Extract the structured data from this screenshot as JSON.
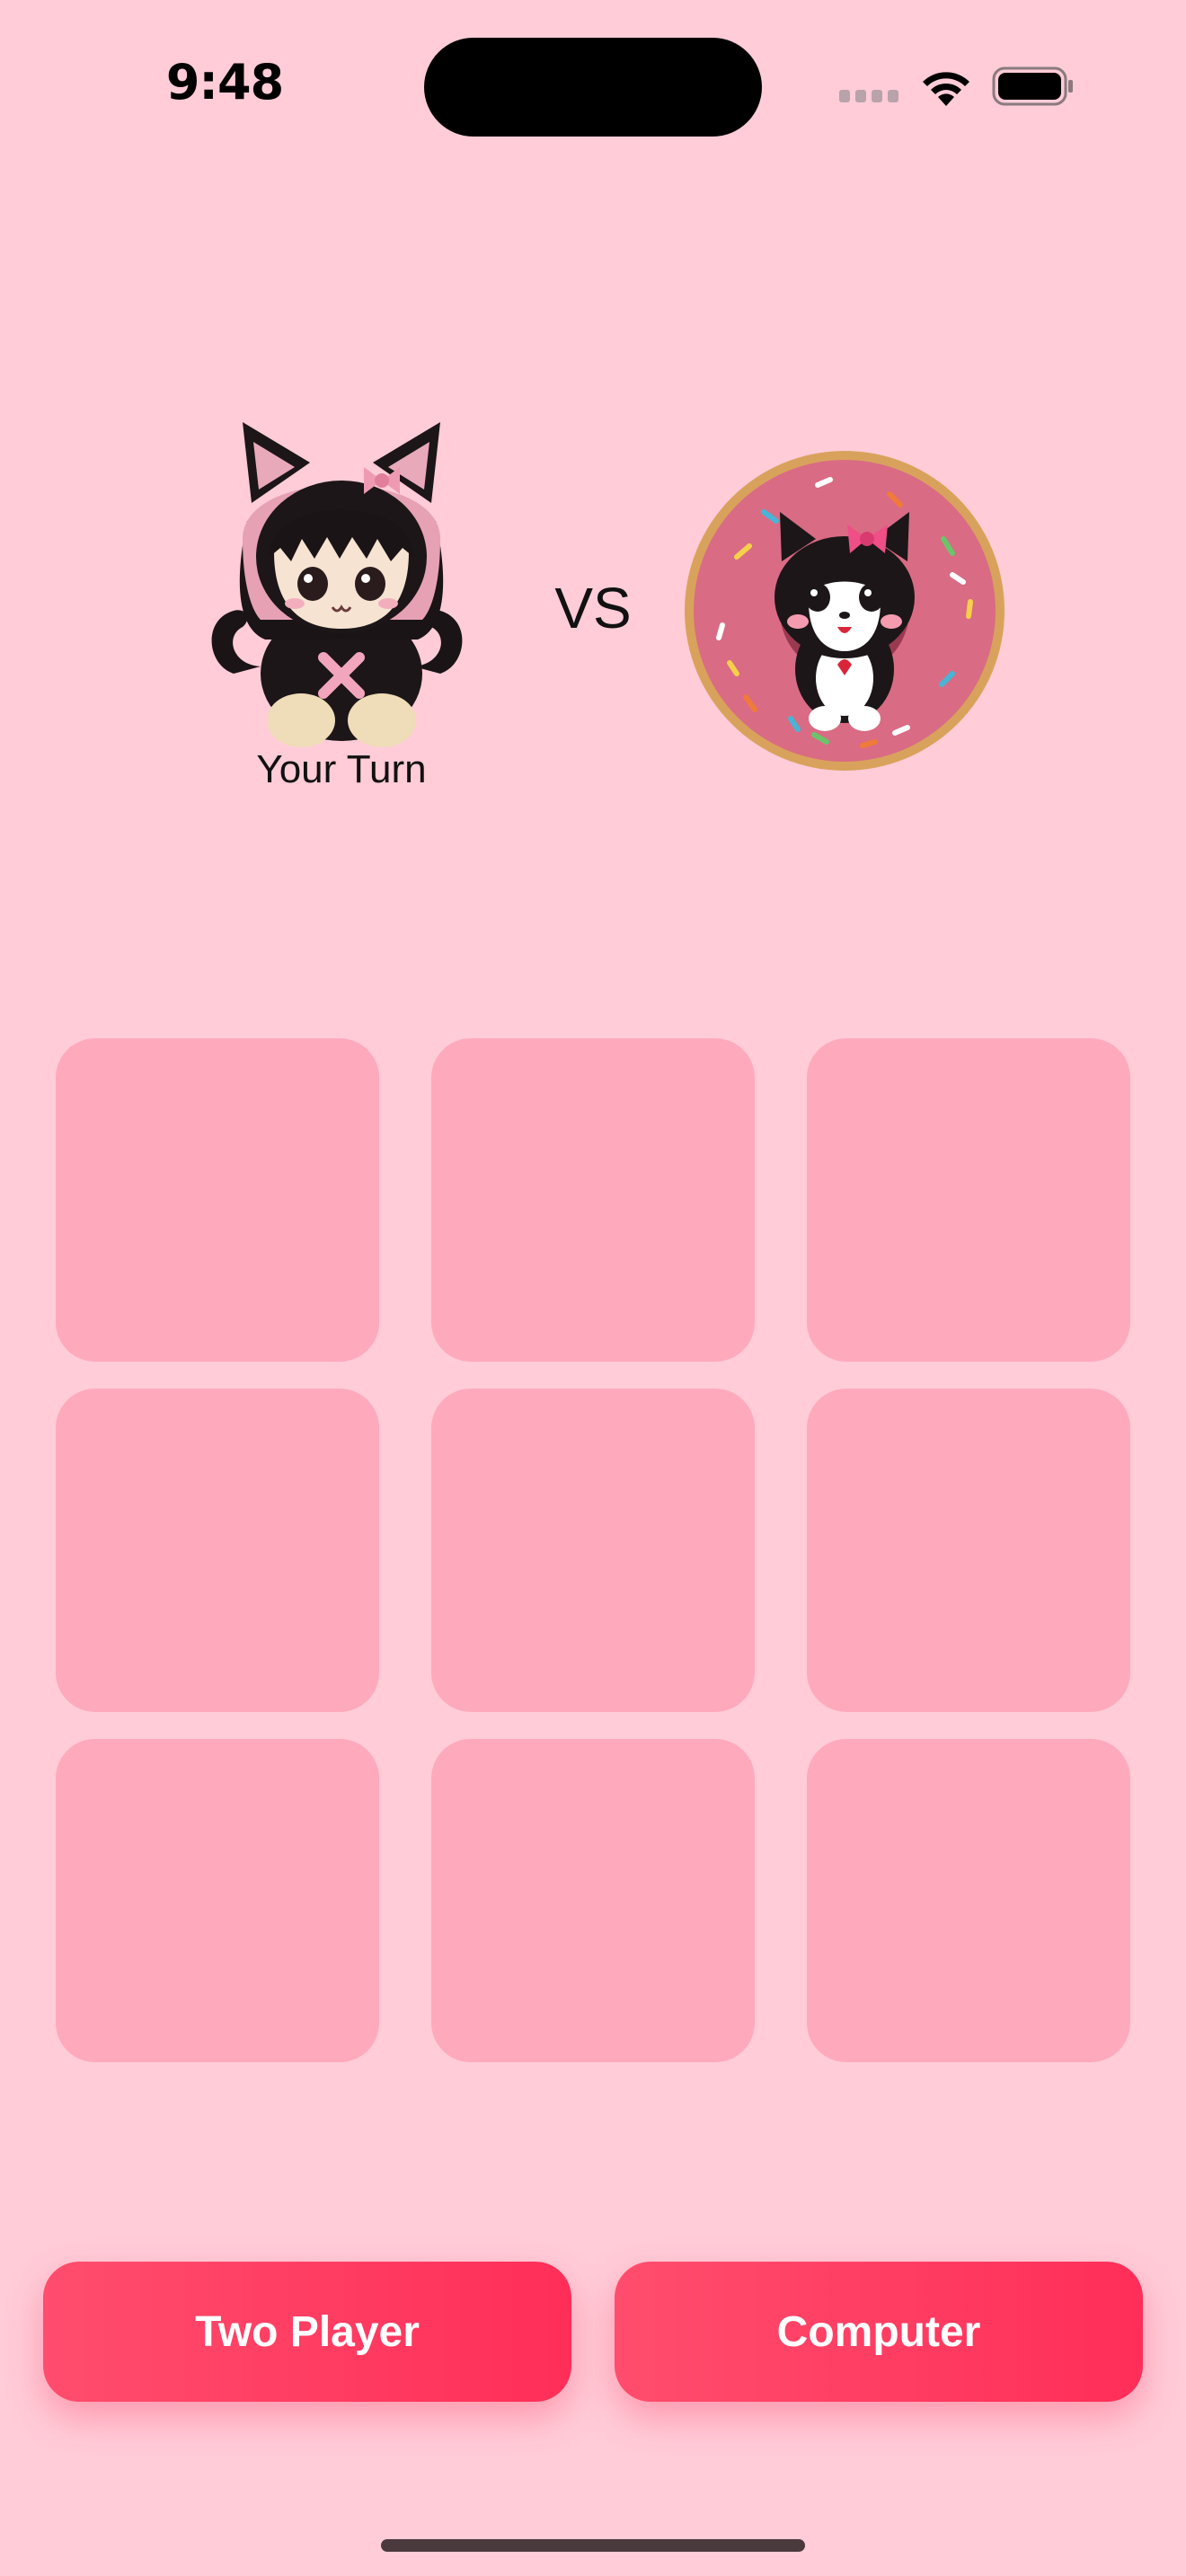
{
  "status_bar": {
    "time": "9:48",
    "icons": [
      "signal-icon",
      "wifi-icon",
      "battery-icon"
    ]
  },
  "players": {
    "player_x": {
      "avatar": "kitten-doll-x-avatar",
      "label": "Your Turn"
    },
    "versus": "VS",
    "player_o": {
      "avatar": "kitten-donut-o-avatar"
    }
  },
  "board": {
    "cells": [
      "",
      "",
      "",
      "",
      "",
      "",
      "",
      "",
      ""
    ]
  },
  "modes": {
    "two_player_label": "Two Player",
    "computer_label": "Computer"
  },
  "colors": {
    "background": "#FFCCD8",
    "cell": "#FFA9BC",
    "button": "#FF3D62",
    "button_text": "#FFFFFF"
  }
}
